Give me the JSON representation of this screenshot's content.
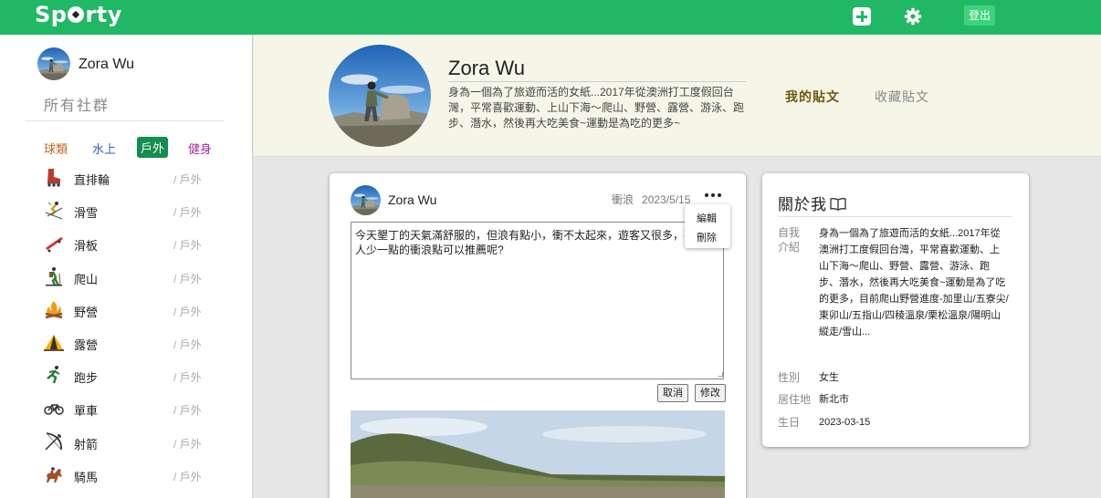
{
  "app": {
    "logo": "Sporty",
    "logout_label": "登出"
  },
  "sidebar": {
    "user_name": "Zora Wu",
    "all_communities": "所有社群",
    "category_tabs": [
      "球類",
      "水上",
      "戶外",
      "健身"
    ],
    "active_tab": "戶外",
    "items": [
      {
        "name": "直排輪",
        "category": "/ 戶外",
        "icon": "inline-skate-icon"
      },
      {
        "name": "滑雪",
        "category": "/ 戶外",
        "icon": "skier-icon"
      },
      {
        "name": "滑板",
        "category": "/ 戶外",
        "icon": "skateboard-icon"
      },
      {
        "name": "爬山",
        "category": "/ 戶外",
        "icon": "hiker-icon"
      },
      {
        "name": "野營",
        "category": "/ 戶外",
        "icon": "campfire-icon"
      },
      {
        "name": "露營",
        "category": "/ 戶外",
        "icon": "tent-icon"
      },
      {
        "name": "跑步",
        "category": "/ 戶外",
        "icon": "runner-icon"
      },
      {
        "name": "單車",
        "category": "/ 戶外",
        "icon": "bicycle-icon"
      },
      {
        "name": "射箭",
        "category": "/ 戶外",
        "icon": "bow-arrow-icon"
      },
      {
        "name": "騎馬",
        "category": "/ 戶外",
        "icon": "horse-riding-icon"
      }
    ]
  },
  "profile": {
    "name": "Zora Wu",
    "bio": "身為一個為了旅遊而活的女紙...2017年從澳洲打工度假回台灣，平常喜歡運動、上山下海～爬山、野營、露營、游泳、跑步、潛水，然後再大吃美食~運動是為吃的更多~",
    "tabs": [
      "我的貼文",
      "收藏貼文"
    ],
    "active_tab": "我的貼文"
  },
  "post": {
    "user": "Zora Wu",
    "category": "衝浪",
    "date": "2023/5/15",
    "content": "今天墾丁的天氣滿舒服的，但浪有點小，衝不太起來，遊客又很多，有附近人少一點的衝浪點可以推薦呢?",
    "menu": [
      "編輯",
      "刪除"
    ],
    "cancel_label": "取消",
    "modify_label": "修改"
  },
  "about": {
    "title": "關於我",
    "intro_label": "自我介紹",
    "intro": "身為一個為了旅遊而活的女紙...2017年從澳洲打工度假回台灣，平常喜歡運動、上山下海～爬山、野營、露營、游泳、跑步、潛水，然後再大吃美食~運動是為了吃的更多，目前爬山野營進度-加里山/五寮尖/東卯山/五指山/四稜溫泉/栗松溫泉/陽明山縱走/雪山...",
    "gender_label": "性別",
    "gender": "女生",
    "residence_label": "居住地",
    "residence": "新北市",
    "birthday_label": "生日",
    "birthday": "2023-03-15"
  },
  "colors": {
    "brand": "#20b865",
    "active_tab_bg": "#138e4d",
    "header_bg": "#f6f6e8"
  }
}
